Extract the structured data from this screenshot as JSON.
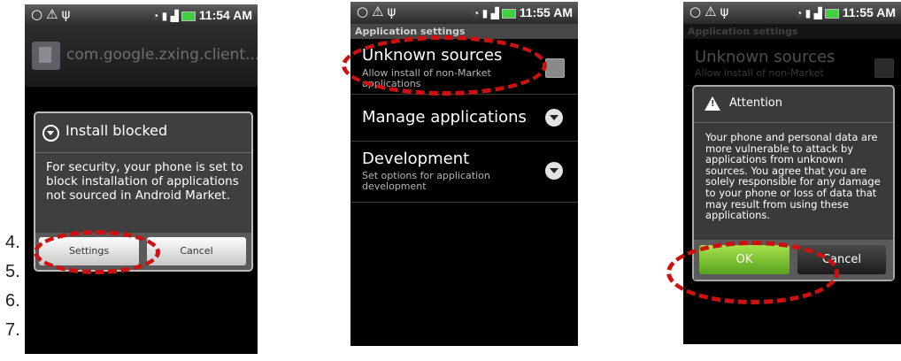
{
  "screens": [
    {
      "status": {
        "time": "11:54 AM"
      },
      "package_name": "com.google.zxing.client...",
      "dialog": {
        "title": "Install blocked",
        "message": "For security, your phone is set to block installation of applications not sourced in Android Market.",
        "buttons": [
          "Settings",
          "Cancel"
        ]
      },
      "step_numbers": [
        "4.",
        "5.",
        "6.",
        "7."
      ]
    },
    {
      "status": {
        "time": "11:55 AM"
      },
      "section_header": "Application settings",
      "rows": [
        {
          "title": "Unknown sources",
          "subtitle": "Allow install of non-Market applications"
        },
        {
          "title": "Manage applications",
          "subtitle": ""
        },
        {
          "title": "Development",
          "subtitle": "Set options for application development"
        }
      ]
    },
    {
      "status": {
        "time": "11:55 AM"
      },
      "section_header": "Application settings",
      "bg_row": {
        "title": "Unknown sources",
        "subtitle": "Allow install of non-Market"
      },
      "dialog": {
        "title": "Attention",
        "message": "Your phone and personal data are more vulnerable to attack by applications from unknown sources. You agree that you are solely responsible for any damage to your phone or loss of data that may result from using these applications.",
        "buttons": [
          "OK",
          "Cancel"
        ]
      }
    }
  ],
  "icons": {
    "status_left": "sync-warning-usb-icons",
    "status_right": "wifi-signal-battery-icons"
  },
  "colors": {
    "highlight": "#cc1111",
    "ok_button": "#7ac335",
    "dialog_bg": "#3f3f3f"
  }
}
